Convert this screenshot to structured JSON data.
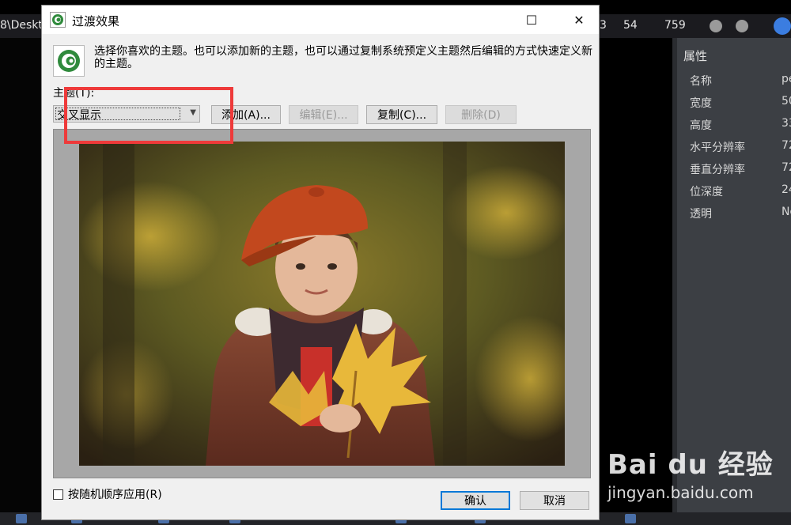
{
  "background": {
    "path_text": "8\\Deskt",
    "numbers": [
      "3",
      "54",
      "759"
    ],
    "properties_panel": {
      "title": "属性",
      "rows": [
        {
          "key": "名称",
          "value": "pe"
        },
        {
          "key": "宽度",
          "value": "50"
        },
        {
          "key": "高度",
          "value": "33"
        },
        {
          "key": "水平分辨率",
          "value": "72"
        },
        {
          "key": "垂直分辨率",
          "value": "72"
        },
        {
          "key": "位深度",
          "value": "24"
        },
        {
          "key": "透明",
          "value": "No"
        }
      ]
    },
    "watermark": {
      "main": "Bai du 经验",
      "sub": "jingyan.baidu.com"
    }
  },
  "dialog": {
    "title": "过渡效果",
    "controls": {
      "maximize": "☐",
      "close": "✕"
    },
    "intro": "选择你喜欢的主题。也可以添加新的主题，也可以通过复制系统预定义主题然后编辑的方式快速定义新的主题。",
    "theme_label": "主题(T):",
    "theme_value": "交叉显示",
    "buttons": {
      "add": "添加(A)...",
      "edit": "编辑(E)...",
      "copy": "复制(C)...",
      "delete": "删除(D)"
    },
    "random_order_label": "按随机顺序应用(R)",
    "ok": "确认",
    "cancel": "取消"
  },
  "colors": {
    "highlight_box": "#ee3a3a",
    "focus_border": "#0078d7"
  }
}
